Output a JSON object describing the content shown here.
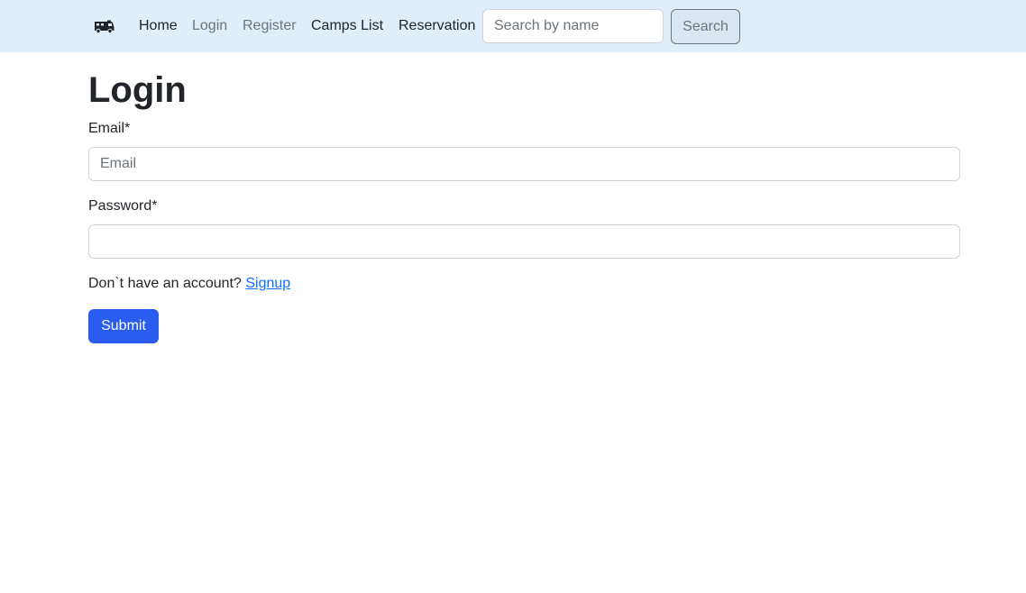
{
  "navbar": {
    "brand_icon": "camper-van-icon",
    "links": {
      "home": "Home",
      "login": "Login",
      "register": "Register",
      "camps_list": "Camps List",
      "reservation": "Reservation"
    },
    "search": {
      "placeholder": "Search by name",
      "value": "",
      "button_label": "Search"
    }
  },
  "page": {
    "title": "Login"
  },
  "form": {
    "email": {
      "label": "Email*",
      "placeholder": "Email",
      "value": ""
    },
    "password": {
      "label": "Password*",
      "placeholder": "",
      "value": ""
    },
    "signup_prompt": "Don`t have an account?",
    "signup_link": "Signup",
    "submit_label": "Submit"
  },
  "colors": {
    "navbar_background": "#e0eefc",
    "primary": "#2b5cf0",
    "link": "#0d6efd",
    "muted_text": "#6c737a"
  }
}
